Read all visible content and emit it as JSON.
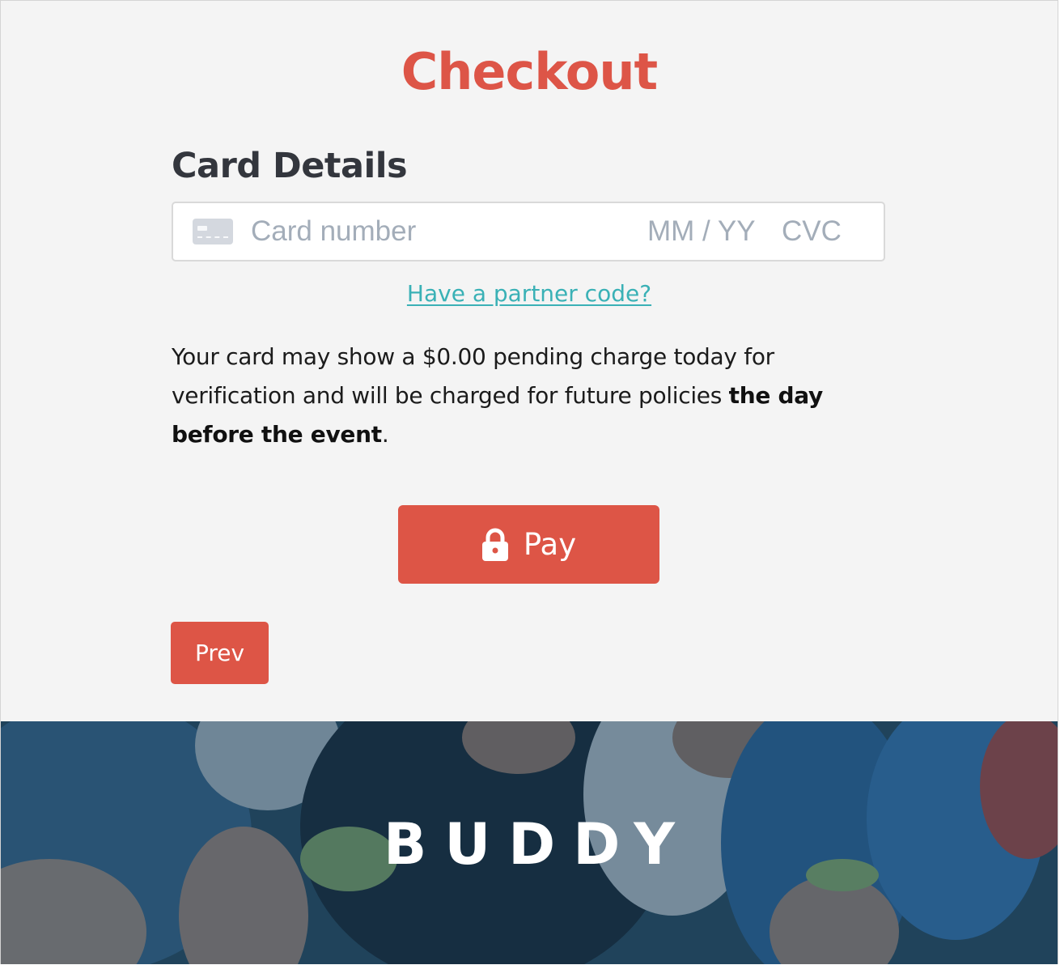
{
  "page": {
    "title": "Checkout"
  },
  "card_details": {
    "heading": "Card Details",
    "card_number_placeholder": "Card number",
    "expiry_placeholder": "MM / YY",
    "cvc_placeholder": "CVC",
    "icon": "credit-card-icon"
  },
  "partner_link": {
    "label": "Have a partner code?"
  },
  "notice": {
    "text_before": "Your card may show a $0.00 pending charge today for verification and will be charged for future policies ",
    "bold_text": "the day before the event",
    "text_after": "."
  },
  "pay_button": {
    "label": "Pay",
    "icon": "lock-icon"
  },
  "prev_button": {
    "label": "Prev"
  },
  "footer": {
    "brand": "BUDDY"
  },
  "colors": {
    "accent": "#dd5546",
    "link": "#3ab1b6",
    "heading": "#33363d",
    "panel_background": "#f4f4f4",
    "footer_overlay": "#173d55"
  }
}
